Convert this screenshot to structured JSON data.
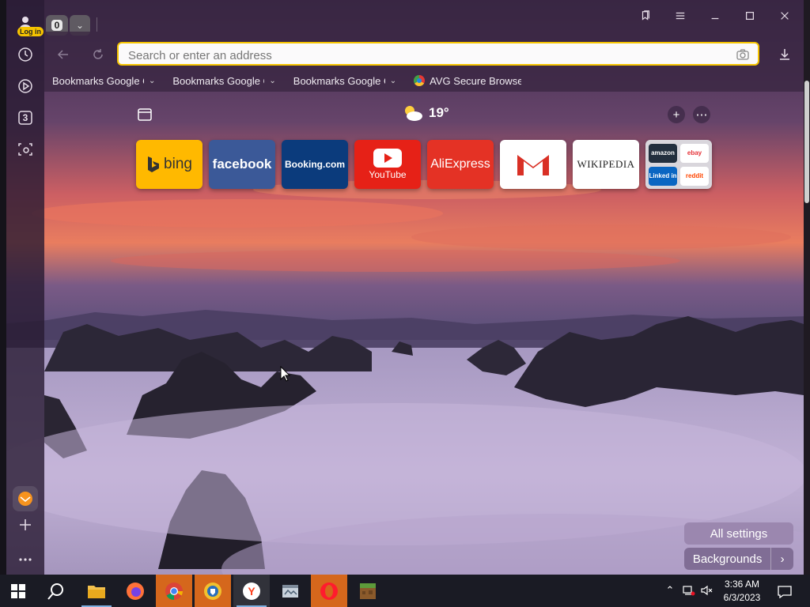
{
  "browser": {
    "login_label": "Log in",
    "tab_count": "0",
    "sidebar": [
      {
        "name": "history-icon",
        "label": "History"
      },
      {
        "name": "video-icon",
        "label": "Video"
      },
      {
        "name": "tabs-count-icon",
        "label": "3"
      },
      {
        "name": "screenshot-icon",
        "label": "Screenshot"
      }
    ]
  },
  "address_bar": {
    "placeholder": "Search or enter an address",
    "value": ""
  },
  "bookmarks": [
    {
      "label": "Bookmarks Google Ch",
      "has_menu": true
    },
    {
      "label": "Bookmarks Google Ch",
      "has_menu": true
    },
    {
      "label": "Bookmarks Google Ch",
      "has_menu": true
    },
    {
      "label": "AVG Secure Browser",
      "has_menu": false
    }
  ],
  "new_tab": {
    "weather_temp": "19°",
    "tiles": [
      {
        "name": "bing",
        "label": "bing"
      },
      {
        "name": "facebook",
        "label": "facebook"
      },
      {
        "name": "booking",
        "label": "Booking.com"
      },
      {
        "name": "youtube",
        "label": "YouTube"
      },
      {
        "name": "aliexpress",
        "label": "AliExpress"
      },
      {
        "name": "gmail",
        "label": ""
      },
      {
        "name": "wikipedia",
        "label": "WIKIPEDIA"
      },
      {
        "name": "multi",
        "items": [
          "amazon",
          "ebay",
          "Linked in",
          "reddit"
        ]
      }
    ],
    "all_settings": "All settings",
    "backgrounds": "Backgrounds"
  },
  "taskbar": {
    "time": "3:36 AM",
    "date": "6/3/2023",
    "apps": [
      "file-explorer",
      "firefox",
      "chrome",
      "avg-browser",
      "yandex-browser",
      "app-window",
      "opera",
      "minecraft"
    ]
  },
  "colors": {
    "accent": "#f5c400",
    "panel": "#382640",
    "taskbar": "#1a1b24"
  }
}
